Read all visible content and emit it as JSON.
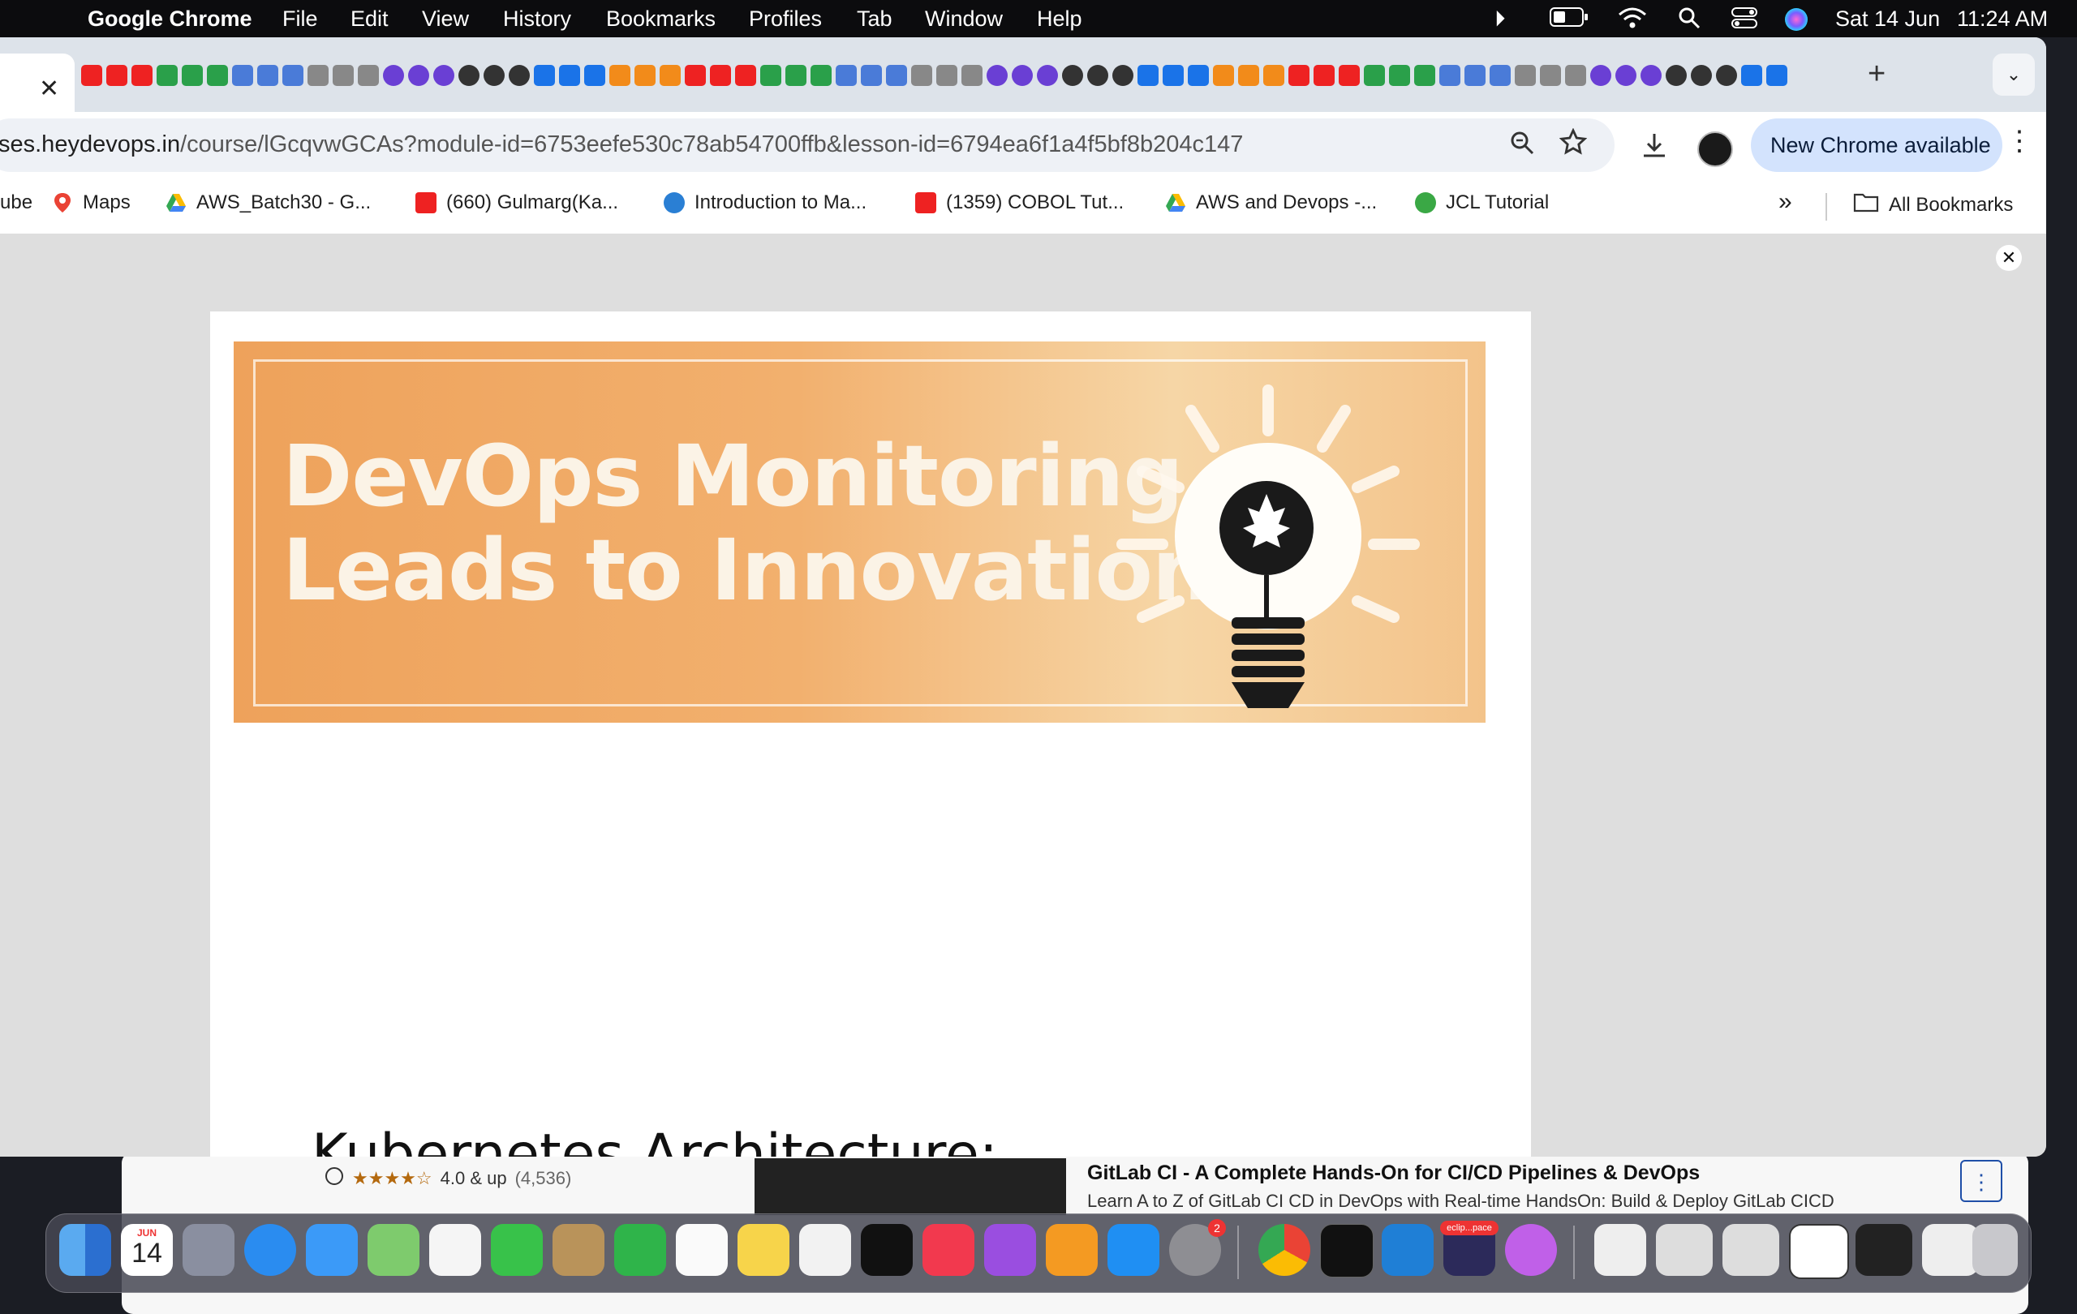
{
  "menubar": {
    "app_name": "Google Chrome",
    "items": [
      "File",
      "Edit",
      "View",
      "History",
      "Bookmarks",
      "Profiles",
      "Tab",
      "Window",
      "Help"
    ],
    "date": "Sat 14 Jun",
    "time": "11:24 AM"
  },
  "tab_strip": {
    "active_tab_close": "✕",
    "new_tab": "+",
    "tab_list": "⌄"
  },
  "toolbar": {
    "url_domain": "ses.heydevops.in",
    "url_path": "/course/lGcqvwGCAs?module-id=6753eefe530c78ab54700ffb&lesson-id=6794ea6f1a4f5bf8b204c147",
    "update_label": "New Chrome available",
    "update_menu": "⋮"
  },
  "bookmarks": {
    "items": [
      "ube",
      "Maps",
      "AWS_Batch30 - G...",
      "(660) Gulmarg(Ka...",
      "Introduction to Ma...",
      "(1359) COBOL Tut...",
      "AWS and Devops -...",
      "JCL Tutorial"
    ],
    "overflow": "»",
    "all_bookmarks": "All Bookmarks"
  },
  "lightbox": {
    "close": "✕",
    "banner_line1": "DevOps Monitoring",
    "banner_line2": "Leads to Innovations",
    "heading": "Kubernetes Architecture:"
  },
  "course_strip": {
    "rating_text": "4.0 & up",
    "rating_count": "(4,536)",
    "title": "GitLab CI - A Complete Hands-On for CI/CD Pipelines & DevOps",
    "subtitle": "Learn A to Z of GitLab CI CD in DevOps with Real-time HandsOn: Build & Deploy GitLab CICD",
    "more": "⋮"
  },
  "dock": {
    "calendar_month": "JUN",
    "calendar_day": "14",
    "settings_badge": "2",
    "eclipse_label": "eclip...pace"
  },
  "colors": {
    "banner_orange": "#eea25b",
    "update_button": "#d3e3fd",
    "omnibox": "#eef1f6"
  }
}
